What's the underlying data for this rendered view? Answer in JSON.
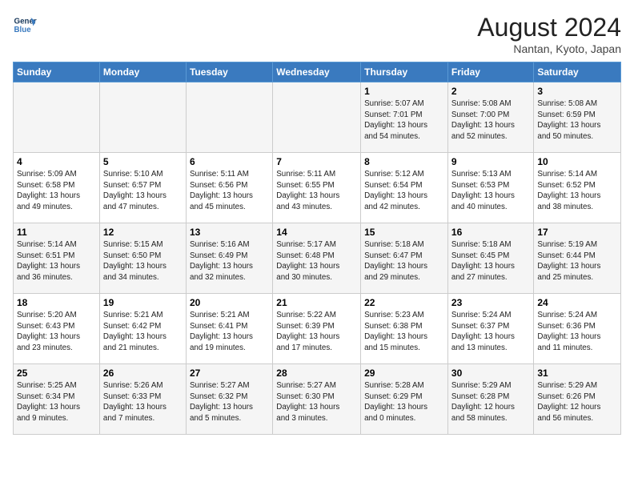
{
  "header": {
    "logo_line1": "General",
    "logo_line2": "Blue",
    "title": "August 2024",
    "subtitle": "Nantan, Kyoto, Japan"
  },
  "days_of_week": [
    "Sunday",
    "Monday",
    "Tuesday",
    "Wednesday",
    "Thursday",
    "Friday",
    "Saturday"
  ],
  "weeks": [
    [
      {
        "day": "",
        "info": ""
      },
      {
        "day": "",
        "info": ""
      },
      {
        "day": "",
        "info": ""
      },
      {
        "day": "",
        "info": ""
      },
      {
        "day": "1",
        "info": "Sunrise: 5:07 AM\nSunset: 7:01 PM\nDaylight: 13 hours\nand 54 minutes."
      },
      {
        "day": "2",
        "info": "Sunrise: 5:08 AM\nSunset: 7:00 PM\nDaylight: 13 hours\nand 52 minutes."
      },
      {
        "day": "3",
        "info": "Sunrise: 5:08 AM\nSunset: 6:59 PM\nDaylight: 13 hours\nand 50 minutes."
      }
    ],
    [
      {
        "day": "4",
        "info": "Sunrise: 5:09 AM\nSunset: 6:58 PM\nDaylight: 13 hours\nand 49 minutes."
      },
      {
        "day": "5",
        "info": "Sunrise: 5:10 AM\nSunset: 6:57 PM\nDaylight: 13 hours\nand 47 minutes."
      },
      {
        "day": "6",
        "info": "Sunrise: 5:11 AM\nSunset: 6:56 PM\nDaylight: 13 hours\nand 45 minutes."
      },
      {
        "day": "7",
        "info": "Sunrise: 5:11 AM\nSunset: 6:55 PM\nDaylight: 13 hours\nand 43 minutes."
      },
      {
        "day": "8",
        "info": "Sunrise: 5:12 AM\nSunset: 6:54 PM\nDaylight: 13 hours\nand 42 minutes."
      },
      {
        "day": "9",
        "info": "Sunrise: 5:13 AM\nSunset: 6:53 PM\nDaylight: 13 hours\nand 40 minutes."
      },
      {
        "day": "10",
        "info": "Sunrise: 5:14 AM\nSunset: 6:52 PM\nDaylight: 13 hours\nand 38 minutes."
      }
    ],
    [
      {
        "day": "11",
        "info": "Sunrise: 5:14 AM\nSunset: 6:51 PM\nDaylight: 13 hours\nand 36 minutes."
      },
      {
        "day": "12",
        "info": "Sunrise: 5:15 AM\nSunset: 6:50 PM\nDaylight: 13 hours\nand 34 minutes."
      },
      {
        "day": "13",
        "info": "Sunrise: 5:16 AM\nSunset: 6:49 PM\nDaylight: 13 hours\nand 32 minutes."
      },
      {
        "day": "14",
        "info": "Sunrise: 5:17 AM\nSunset: 6:48 PM\nDaylight: 13 hours\nand 30 minutes."
      },
      {
        "day": "15",
        "info": "Sunrise: 5:18 AM\nSunset: 6:47 PM\nDaylight: 13 hours\nand 29 minutes."
      },
      {
        "day": "16",
        "info": "Sunrise: 5:18 AM\nSunset: 6:45 PM\nDaylight: 13 hours\nand 27 minutes."
      },
      {
        "day": "17",
        "info": "Sunrise: 5:19 AM\nSunset: 6:44 PM\nDaylight: 13 hours\nand 25 minutes."
      }
    ],
    [
      {
        "day": "18",
        "info": "Sunrise: 5:20 AM\nSunset: 6:43 PM\nDaylight: 13 hours\nand 23 minutes."
      },
      {
        "day": "19",
        "info": "Sunrise: 5:21 AM\nSunset: 6:42 PM\nDaylight: 13 hours\nand 21 minutes."
      },
      {
        "day": "20",
        "info": "Sunrise: 5:21 AM\nSunset: 6:41 PM\nDaylight: 13 hours\nand 19 minutes."
      },
      {
        "day": "21",
        "info": "Sunrise: 5:22 AM\nSunset: 6:39 PM\nDaylight: 13 hours\nand 17 minutes."
      },
      {
        "day": "22",
        "info": "Sunrise: 5:23 AM\nSunset: 6:38 PM\nDaylight: 13 hours\nand 15 minutes."
      },
      {
        "day": "23",
        "info": "Sunrise: 5:24 AM\nSunset: 6:37 PM\nDaylight: 13 hours\nand 13 minutes."
      },
      {
        "day": "24",
        "info": "Sunrise: 5:24 AM\nSunset: 6:36 PM\nDaylight: 13 hours\nand 11 minutes."
      }
    ],
    [
      {
        "day": "25",
        "info": "Sunrise: 5:25 AM\nSunset: 6:34 PM\nDaylight: 13 hours\nand 9 minutes."
      },
      {
        "day": "26",
        "info": "Sunrise: 5:26 AM\nSunset: 6:33 PM\nDaylight: 13 hours\nand 7 minutes."
      },
      {
        "day": "27",
        "info": "Sunrise: 5:27 AM\nSunset: 6:32 PM\nDaylight: 13 hours\nand 5 minutes."
      },
      {
        "day": "28",
        "info": "Sunrise: 5:27 AM\nSunset: 6:30 PM\nDaylight: 13 hours\nand 3 minutes."
      },
      {
        "day": "29",
        "info": "Sunrise: 5:28 AM\nSunset: 6:29 PM\nDaylight: 13 hours\nand 0 minutes."
      },
      {
        "day": "30",
        "info": "Sunrise: 5:29 AM\nSunset: 6:28 PM\nDaylight: 12 hours\nand 58 minutes."
      },
      {
        "day": "31",
        "info": "Sunrise: 5:29 AM\nSunset: 6:26 PM\nDaylight: 12 hours\nand 56 minutes."
      }
    ]
  ]
}
